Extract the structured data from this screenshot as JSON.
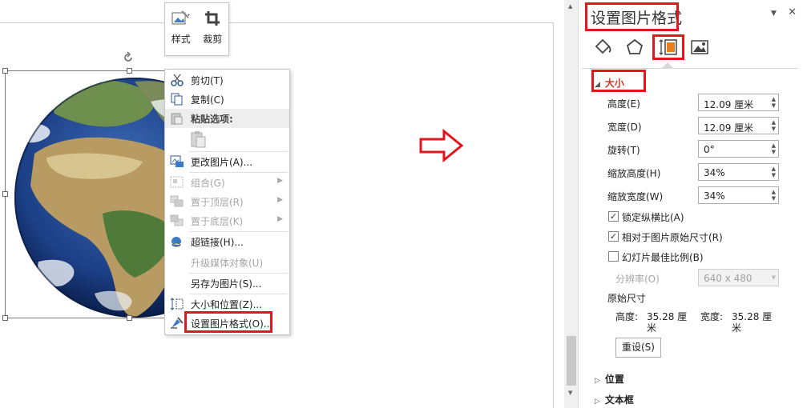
{
  "mini_toolbar": {
    "style_label": "样式",
    "crop_label": "裁剪"
  },
  "context_menu": {
    "cut": "剪切(T)",
    "copy": "复制(C)",
    "paste_options": "粘贴选项:",
    "change_picture": "更改图片(A)...",
    "group": "组合(G)",
    "bring_front": "置于顶层(R)",
    "send_back": "置于底层(K)",
    "hyperlink": "超链接(H)...",
    "upgrade_media": "升级媒体对象(U)",
    "save_as_picture": "另存为图片(S)...",
    "size_position": "大小和位置(Z)...",
    "format_picture": "设置图片格式(O)..."
  },
  "pane": {
    "title": "设置图片格式",
    "section_size": "大小",
    "height_label": "高度(E)",
    "height_value": "12.09 厘米",
    "width_label": "宽度(D)",
    "width_value": "12.09 厘米",
    "rotation_label": "旋转(T)",
    "rotation_value": "0°",
    "scale_height_label": "缩放高度(H)",
    "scale_height_value": "34%",
    "scale_width_label": "缩放宽度(W)",
    "scale_width_value": "34%",
    "lock_aspect": "锁定纵横比(A)",
    "lock_aspect_checked": true,
    "relative_original": "相对于图片原始尺寸(R)",
    "relative_original_checked": true,
    "best_scale": "幻灯片最佳比例(B)",
    "best_scale_checked": false,
    "resolution_label": "分辨率(O)",
    "resolution_value": "640 x 480",
    "original_size_label": "原始尺寸",
    "orig_height_label": "高度:",
    "orig_height_value": "35.28 厘",
    "orig_width_label": "宽度:",
    "orig_width_value": "35.28 厘",
    "unit_wrap": "米",
    "reset_button": "重设(S)",
    "section_position": "位置",
    "section_textbox": "文本框"
  },
  "colors": {
    "highlight_red": "#e2161c",
    "accent": "#c0392b"
  }
}
